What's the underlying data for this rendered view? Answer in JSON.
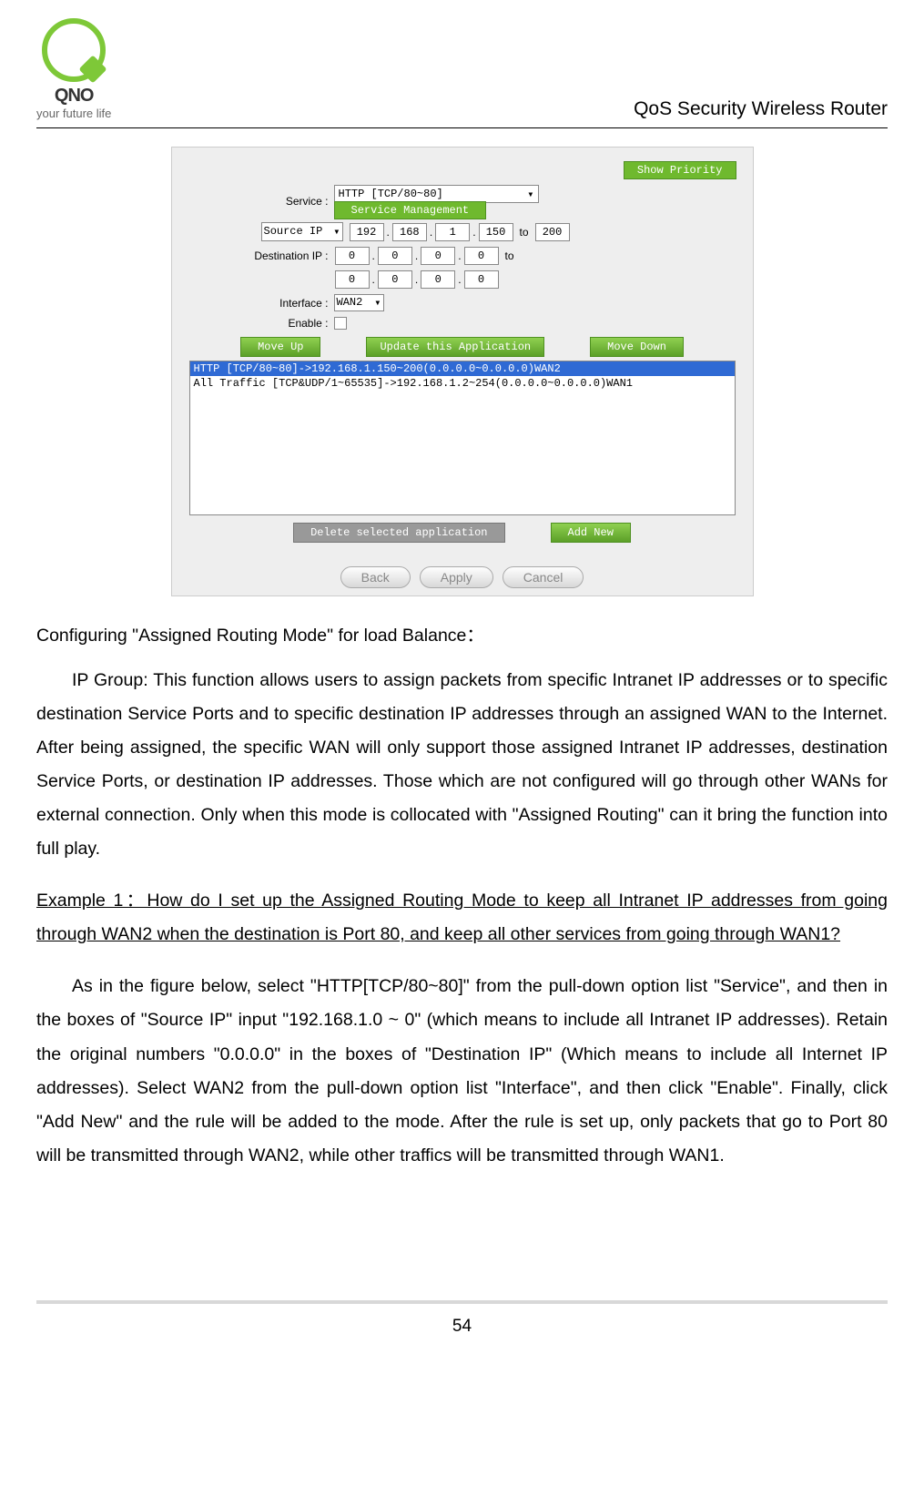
{
  "header": {
    "brand": "QNO",
    "tagline": "your future life",
    "title": "QoS Security Wireless Router"
  },
  "screenshot": {
    "show_priority": "Show Priority",
    "service_label": "Service :",
    "service_value": "HTTP [TCP/80~80]",
    "service_mgmt": "Service Management",
    "source_ip_select": "Source IP",
    "src_ip": [
      "192",
      "168",
      "1",
      "150"
    ],
    "src_to": "to",
    "src_end": "200",
    "dest_label": "Destination IP :",
    "dest_ip1": [
      "0",
      "0",
      "0",
      "0"
    ],
    "dest_to": "to",
    "dest_ip2": [
      "0",
      "0",
      "0",
      "0"
    ],
    "iface_label": "Interface :",
    "iface_value": "WAN2",
    "enable_label": "Enable :",
    "btn_moveup": "Move Up",
    "btn_update": "Update this Application",
    "btn_movedown": "Move Down",
    "rule_selected": "HTTP [TCP/80~80]->192.168.1.150~200(0.0.0.0~0.0.0.0)WAN2",
    "rule_other": "All Traffic [TCP&UDP/1~65535]->192.168.1.2~254(0.0.0.0~0.0.0.0)WAN1",
    "btn_delete": "Delete selected application",
    "btn_addnew": "Add New",
    "pill_back": "Back",
    "pill_apply": "Apply",
    "pill_cancel": "Cancel"
  },
  "text": {
    "h1": "Configuring \"Assigned Routing Mode\" for load Balance：",
    "p1": "IP Group: This function allows users to assign packets from specific Intranet IP addresses or to specific destination Service Ports and to specific destination IP addresses through an assigned WAN to the Internet. After being assigned, the specific WAN will only support those assigned Intranet IP addresses, destination Service Ports, or destination IP addresses. Those which are not configured will go through other WANs for external connection. Only when this mode is collocated with \"Assigned Routing\" can it bring the function into full play.",
    "ex_title": "Example 1：How do I set up the Assigned Routing Mode to keep all Intranet IP addresses from going through WAN2 when the destination is Port 80, and keep all other services from going through WAN1?",
    "p2": "As in the figure below, select \"HTTP[TCP/80~80]\" from the pull-down option list \"Service\", and then in the boxes of \"Source IP\" input \"192.168.1.0 ~ 0\" (which means to include all Intranet IP addresses). Retain the original numbers \"0.0.0.0\" in the boxes of \"Destination IP\" (Which means to include all Internet IP addresses). Select WAN2 from the pull-down option list \"Interface\", and then click \"Enable\". Finally, click \"Add New\" and the rule will be added to the mode. After the rule is set up, only packets that go to Port 80 will be transmitted through WAN2, while other traffics will be transmitted through WAN1."
  },
  "page_number": "54"
}
